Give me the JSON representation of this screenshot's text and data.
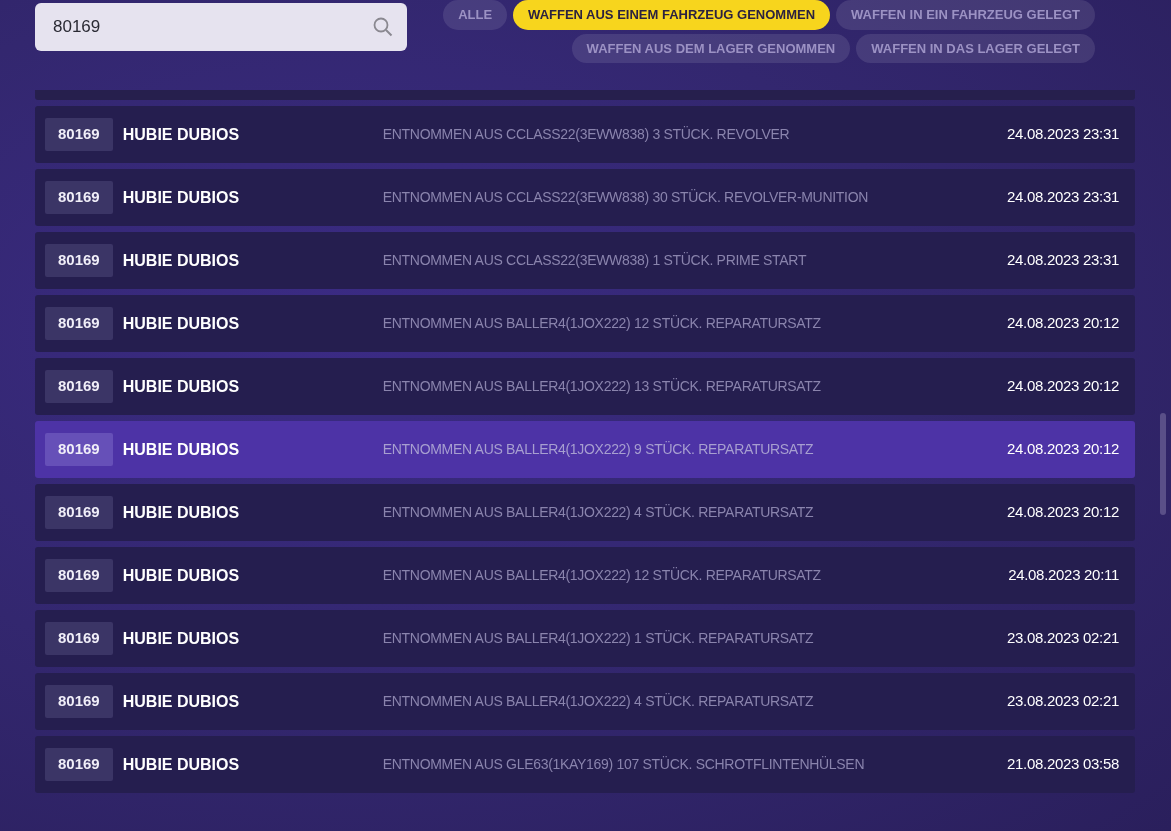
{
  "search": {
    "value": "80169"
  },
  "filters": [
    {
      "label": "ALLE",
      "selected": false
    },
    {
      "label": "WAFFEN AUS EINEM FAHRZEUG GENOMMEN",
      "selected": true
    },
    {
      "label": "WAFFEN IN EIN FAHRZEUG GELEGT",
      "selected": false
    },
    {
      "label": "WAFFEN AUS DEM LAGER GENOMMEN",
      "selected": false
    },
    {
      "label": "WAFFEN IN DAS LAGER GELEGT",
      "selected": false
    }
  ],
  "rows": [
    {
      "id": "80169",
      "name": "HUBIE DUBIOS",
      "description": "ENTNOMMEN AUS CCLASS22(3EWW838) 3 STÜCK. REVOLVER",
      "time": "24.08.2023 23:31",
      "selected": false
    },
    {
      "id": "80169",
      "name": "HUBIE DUBIOS",
      "description": "ENTNOMMEN AUS CCLASS22(3EWW838) 30 STÜCK. REVOLVER-MUNITION",
      "time": "24.08.2023 23:31",
      "selected": false
    },
    {
      "id": "80169",
      "name": "HUBIE DUBIOS",
      "description": "ENTNOMMEN AUS CCLASS22(3EWW838) 1 STÜCK. PRIME START",
      "time": "24.08.2023 23:31",
      "selected": false
    },
    {
      "id": "80169",
      "name": "HUBIE DUBIOS",
      "description": "ENTNOMMEN AUS BALLER4(1JOX222) 12 STÜCK. REPARATURSATZ",
      "time": "24.08.2023 20:12",
      "selected": false
    },
    {
      "id": "80169",
      "name": "HUBIE DUBIOS",
      "description": "ENTNOMMEN AUS BALLER4(1JOX222) 13 STÜCK. REPARATURSATZ",
      "time": "24.08.2023 20:12",
      "selected": false
    },
    {
      "id": "80169",
      "name": "HUBIE DUBIOS",
      "description": "ENTNOMMEN AUS BALLER4(1JOX222) 9 STÜCK. REPARATURSATZ",
      "time": "24.08.2023 20:12",
      "selected": true
    },
    {
      "id": "80169",
      "name": "HUBIE DUBIOS",
      "description": "ENTNOMMEN AUS BALLER4(1JOX222) 4 STÜCK. REPARATURSATZ",
      "time": "24.08.2023 20:12",
      "selected": false
    },
    {
      "id": "80169",
      "name": "HUBIE DUBIOS",
      "description": "ENTNOMMEN AUS BALLER4(1JOX222) 12 STÜCK. REPARATURSATZ",
      "time": "24.08.2023 20:11",
      "selected": false
    },
    {
      "id": "80169",
      "name": "HUBIE DUBIOS",
      "description": "ENTNOMMEN AUS BALLER4(1JOX222) 1 STÜCK. REPARATURSATZ",
      "time": "23.08.2023 02:21",
      "selected": false
    },
    {
      "id": "80169",
      "name": "HUBIE DUBIOS",
      "description": "ENTNOMMEN AUS BALLER4(1JOX222) 4 STÜCK. REPARATURSATZ",
      "time": "23.08.2023 02:21",
      "selected": false
    },
    {
      "id": "80169",
      "name": "HUBIE DUBIOS",
      "description": "ENTNOMMEN AUS GLE63(1KAY169) 107 STÜCK. SCHROTFLINTENHÜLSEN",
      "time": "21.08.2023 03:58",
      "selected": false
    }
  ]
}
